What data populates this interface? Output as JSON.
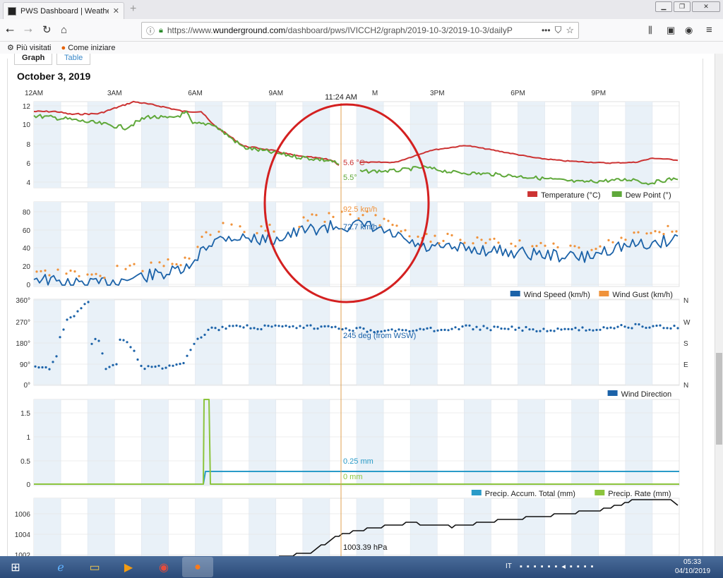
{
  "browser": {
    "tab_title": "PWS Dashboard | Weather Und",
    "url_prefix": "https://www.",
    "url_domain": "wunderground.com",
    "url_path": "/dashboard/pws/IVICCH2/graph/2019-10-3/2019-10-3/dailyP",
    "url_more": "•••",
    "bookmark_1": "Più visitati",
    "bookmark_2": "Come iniziare"
  },
  "page": {
    "tab_graph": "Graph",
    "tab_table": "Table",
    "date": "October 3, 2019",
    "cursor_time": "11:24 AM",
    "hour_labels": [
      "12AM",
      "3AM",
      "6AM",
      "9AM",
      "",
      "3PM",
      "6PM",
      "9PM"
    ],
    "hour_cut_label": "M"
  },
  "charts": {
    "temperature": {
      "y_ticks": [
        "12",
        "10",
        "8",
        "6",
        "4"
      ],
      "readout_temp": "5.6 °C",
      "readout_dew": "5.5°",
      "legend": [
        "Temperature (°C)",
        "Dew Point (°)"
      ],
      "colors": [
        "#cc3333",
        "#5fa83a"
      ]
    },
    "wind": {
      "y_ticks": [
        "80",
        "60",
        "40",
        "20",
        "0"
      ],
      "readout_gust": "92.5 km/h",
      "readout_speed": "72.7 km/h",
      "legend": [
        "Wind Speed (km/h)",
        "Wind Gust (km/h)"
      ],
      "colors": [
        "#1b62a8",
        "#f0923a"
      ]
    },
    "direction": {
      "y_ticks": [
        "360°",
        "270°",
        "180°",
        "90°",
        "0°"
      ],
      "right_ticks": [
        "N",
        "W",
        "S",
        "E",
        "N"
      ],
      "readout": "245 deg (from WSW)",
      "legend": [
        "Wind Direction"
      ],
      "colors": [
        "#1b62a8"
      ]
    },
    "precip": {
      "y_ticks": [
        "1.5",
        "1",
        "0.5",
        "0"
      ],
      "readout_accum": "0.25 mm",
      "readout_rate": "0 mm",
      "legend": [
        "Precip. Accum. Total (mm)",
        "Precip. Rate (mm)"
      ],
      "colors": [
        "#2a9bc8",
        "#8cc43c"
      ]
    },
    "pressure": {
      "y_ticks": [
        "1006",
        "1004",
        "1002"
      ],
      "readout": "1003.39 hPa"
    }
  },
  "taskbar": {
    "lang": "IT",
    "time": "05:33",
    "date": "04/10/2019"
  },
  "accent": {
    "annotation_circle": "#d42020",
    "cursor_line": "#e0a050"
  }
}
